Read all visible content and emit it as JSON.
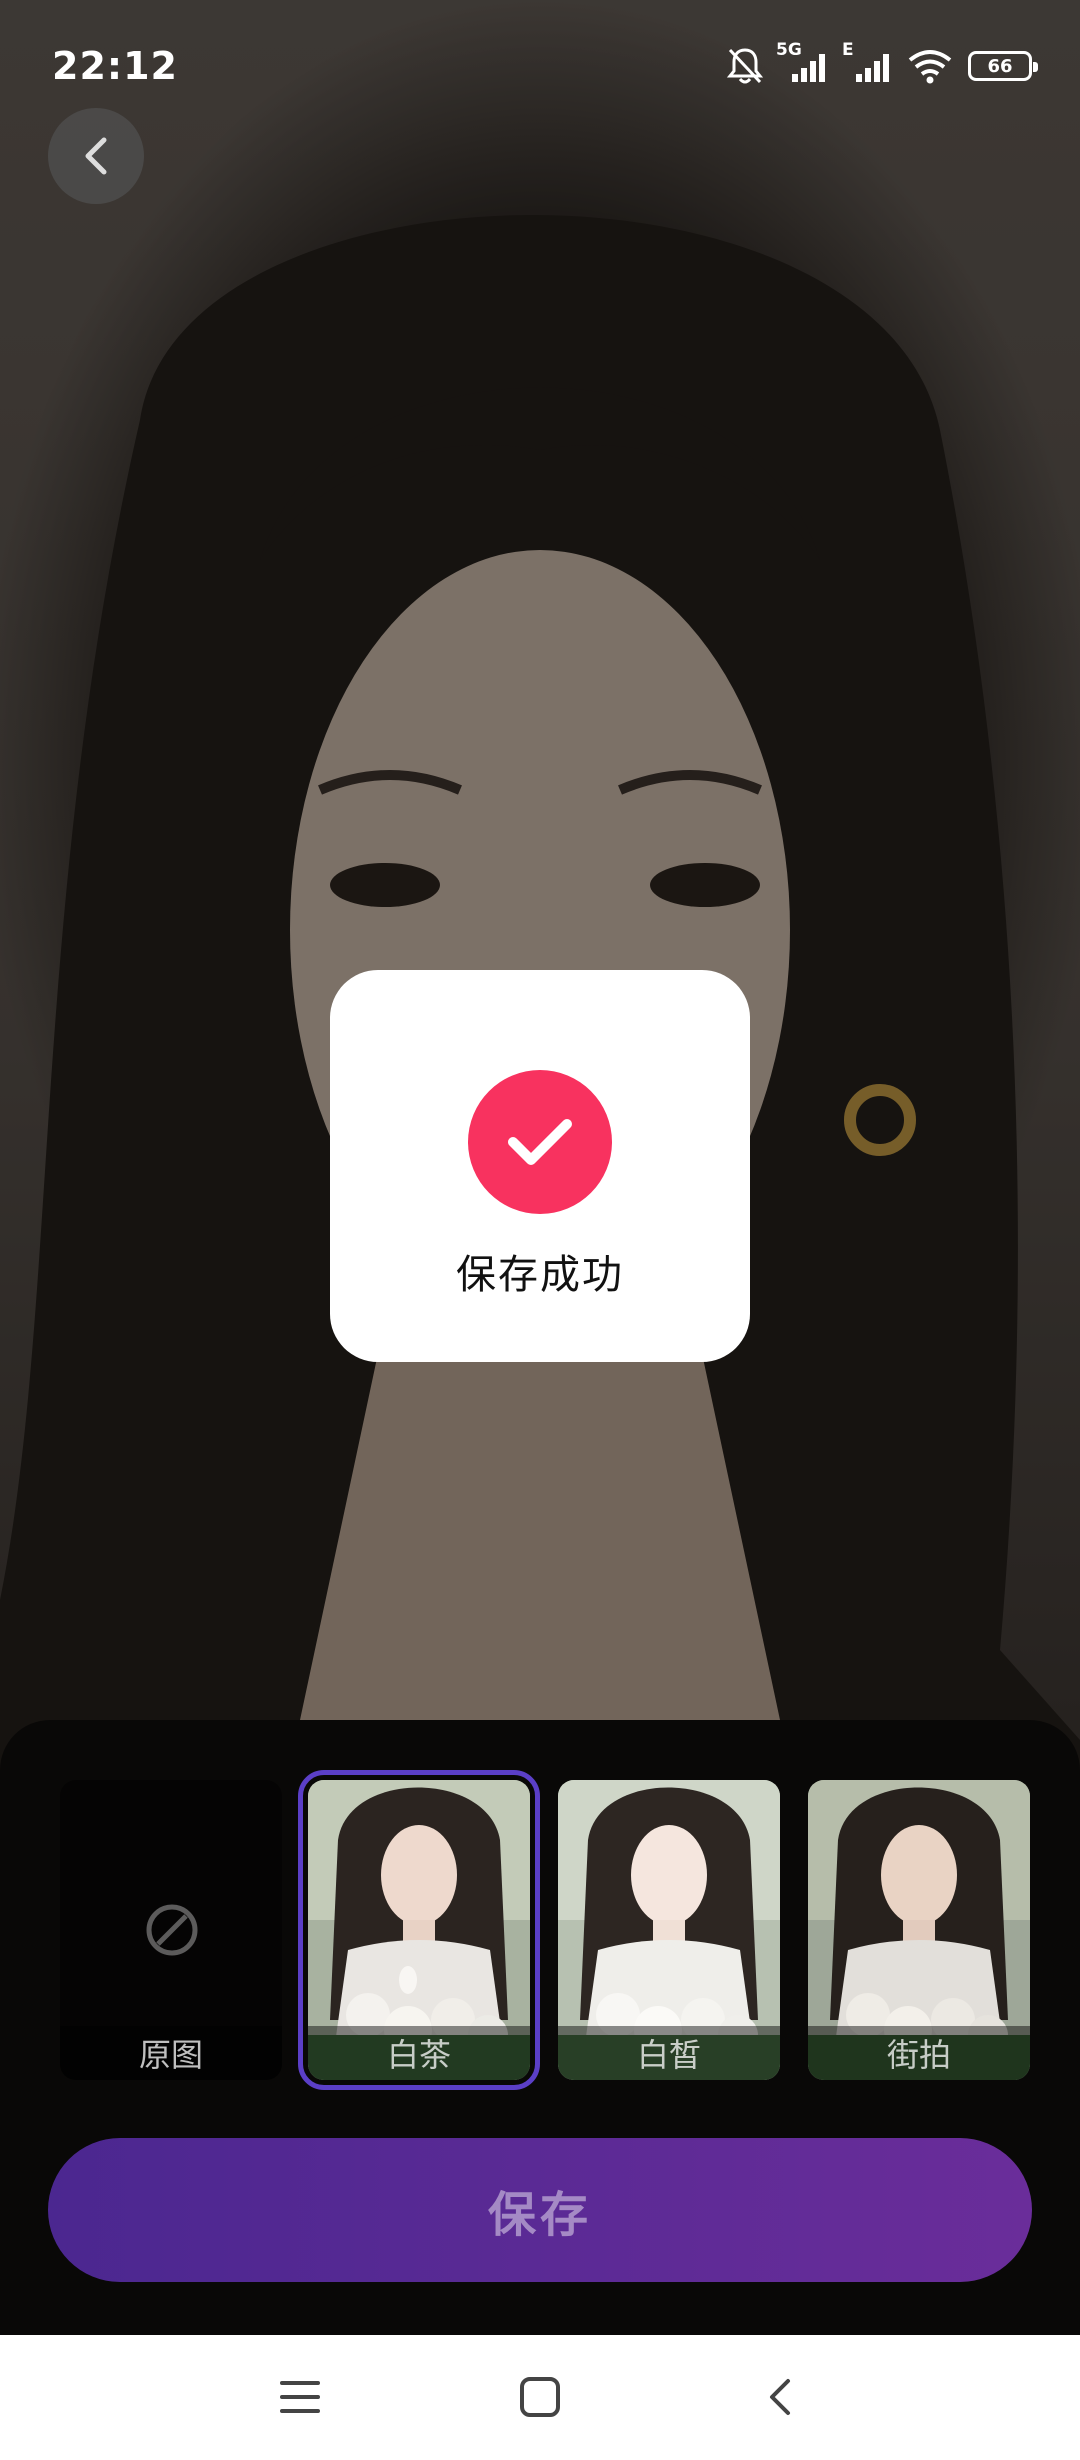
{
  "status_bar": {
    "time": "22:12",
    "network_5g": "5G",
    "network_e": "E",
    "battery_level": "66"
  },
  "toast": {
    "message": "保存成功",
    "accent_color": "#f8325f",
    "icon": "check-icon"
  },
  "filters": [
    {
      "label": "原图",
      "icon": "none-icon",
      "selected": false
    },
    {
      "label": "白茶",
      "selected": true
    },
    {
      "label": "白皙",
      "selected": false
    },
    {
      "label": "街拍",
      "selected": false
    }
  ],
  "save_button": {
    "label": "保存"
  },
  "colors": {
    "save_gradient_start": "#4b2790",
    "save_gradient_end": "#6a2d9a",
    "selected_outline": "#5b3fc7"
  }
}
